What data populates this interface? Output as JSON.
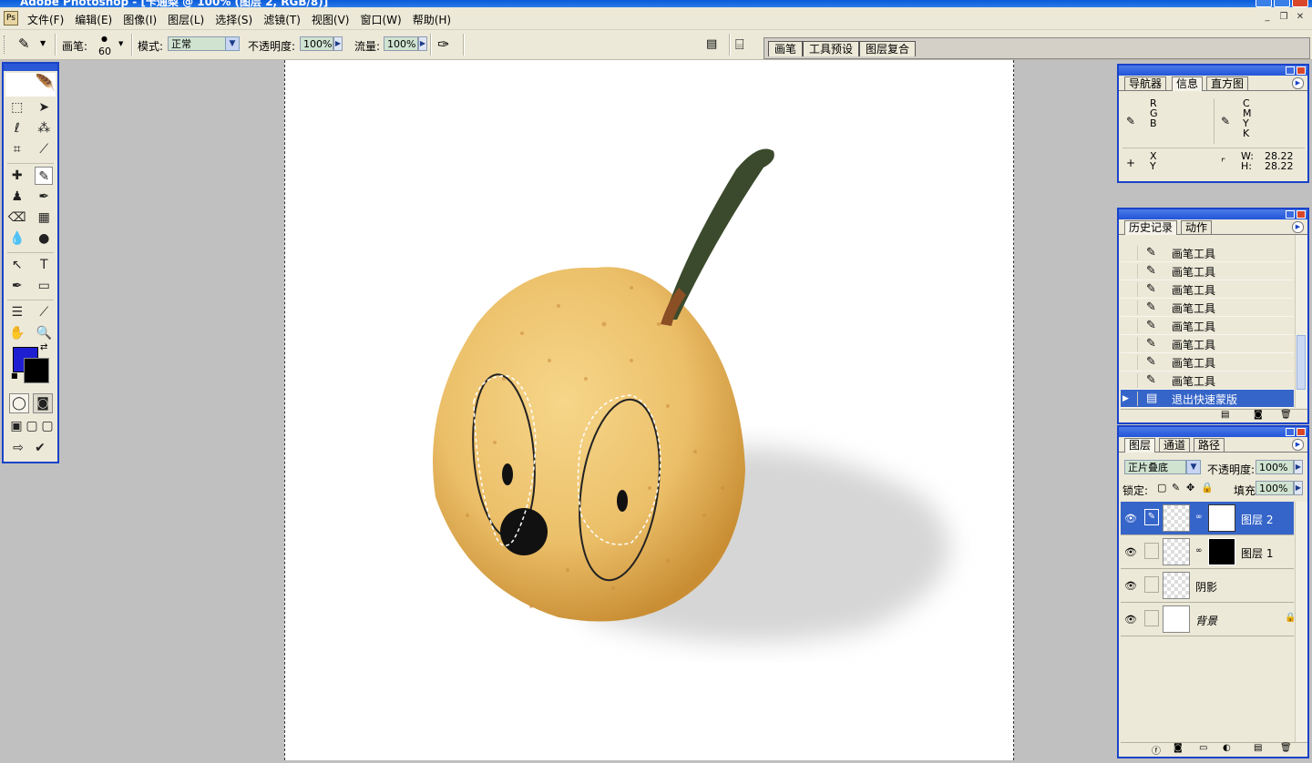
{
  "app": {
    "title": "Adobe Photoshop - [卡通梨 @ 100% (图层 2, RGB/8)]"
  },
  "menu": [
    "文件(F)",
    "编辑(E)",
    "图像(I)",
    "图层(L)",
    "选择(S)",
    "滤镜(T)",
    "视图(V)",
    "窗口(W)",
    "帮助(H)"
  ],
  "options": {
    "brush_label": "画笔:",
    "brush_size": "60",
    "mode_label": "模式:",
    "mode_value": "正常",
    "opacity_label": "不透明度:",
    "opacity_value": "100%",
    "flow_label": "流量:",
    "flow_value": "100%"
  },
  "palette_well": [
    "画笔",
    "工具预设",
    "图层复合"
  ],
  "info_panel": {
    "tabs": [
      "导航器",
      "信息",
      "直方图"
    ],
    "rgb": [
      "R",
      "G",
      "B"
    ],
    "cmyk": [
      "C",
      "M",
      "Y",
      "K"
    ],
    "xy": [
      "X",
      "Y"
    ],
    "w_label": "W:",
    "w_value": "28.22",
    "h_label": "H:",
    "h_value": "28.22"
  },
  "history_panel": {
    "tabs": [
      "历史记录",
      "动作"
    ],
    "items": [
      "画笔工具",
      "画笔工具",
      "画笔工具",
      "画笔工具",
      "画笔工具",
      "画笔工具",
      "画笔工具",
      "画笔工具",
      "退出快速蒙版"
    ]
  },
  "layers_panel": {
    "tabs": [
      "图层",
      "通道",
      "路径"
    ],
    "blend_mode": "正片叠底",
    "opacity_label": "不透明度:",
    "opacity_value": "100%",
    "lock_label": "锁定:",
    "fill_label": "填充:",
    "fill_value": "100%",
    "layers": [
      "图层 2",
      "图层 1",
      "阴影",
      "背景"
    ]
  },
  "colors": {
    "foreground": "#1f1fd2",
    "background": "#000000",
    "accent": "#1a43c9"
  }
}
